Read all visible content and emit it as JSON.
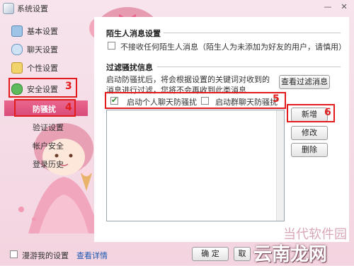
{
  "window": {
    "title": "系统设置"
  },
  "titlebar_buttons": {
    "minimize": "—",
    "close": "✕"
  },
  "sidebar": {
    "items": [
      {
        "label": "基本设置",
        "icon": "monitor-icon"
      },
      {
        "label": "聊天设置",
        "icon": "chat-icon"
      },
      {
        "label": "个性设置",
        "icon": "brush-icon"
      },
      {
        "label": "安全设置",
        "icon": "shield-icon"
      },
      {
        "label": "防骚扰",
        "icon": ""
      },
      {
        "label": "验证设置",
        "icon": ""
      },
      {
        "label": "帐户安全",
        "icon": ""
      },
      {
        "label": "登录历史",
        "icon": ""
      }
    ]
  },
  "annotations": {
    "n3": "3",
    "n4": "4",
    "n5": "5",
    "n6": "6"
  },
  "stranger": {
    "title": "陌生人消息设置",
    "option": "不接收任何陌生人消息（陌生人为未添加为好友的用户，请慎用）",
    "checked": false
  },
  "filter": {
    "title": "过滤骚扰信息",
    "desc_line1": "启动防骚扰后，将会根据设置的关键词对收到的",
    "desc_line2": "消息进行过滤，您将不会再收到此类消息",
    "view_button": "查看过滤消息",
    "personal_label": "启动个人聊天防骚扰",
    "personal_checked": true,
    "group_label": "启动群聊天防骚扰",
    "group_checked": false
  },
  "list_actions": {
    "add": "新增",
    "edit": "修改",
    "delete": "删除"
  },
  "bottom": {
    "roam_label": "漫游我的设置",
    "details_link": "查看详情",
    "ok": "确 定",
    "cancel": "取"
  },
  "watermark": {
    "line1": "当代软件园",
    "line2": "云南龙网"
  },
  "colors": {
    "accent_pink": "#e0557f",
    "annotation_red": "#e21c1c",
    "link_blue": "#1a57b0"
  }
}
